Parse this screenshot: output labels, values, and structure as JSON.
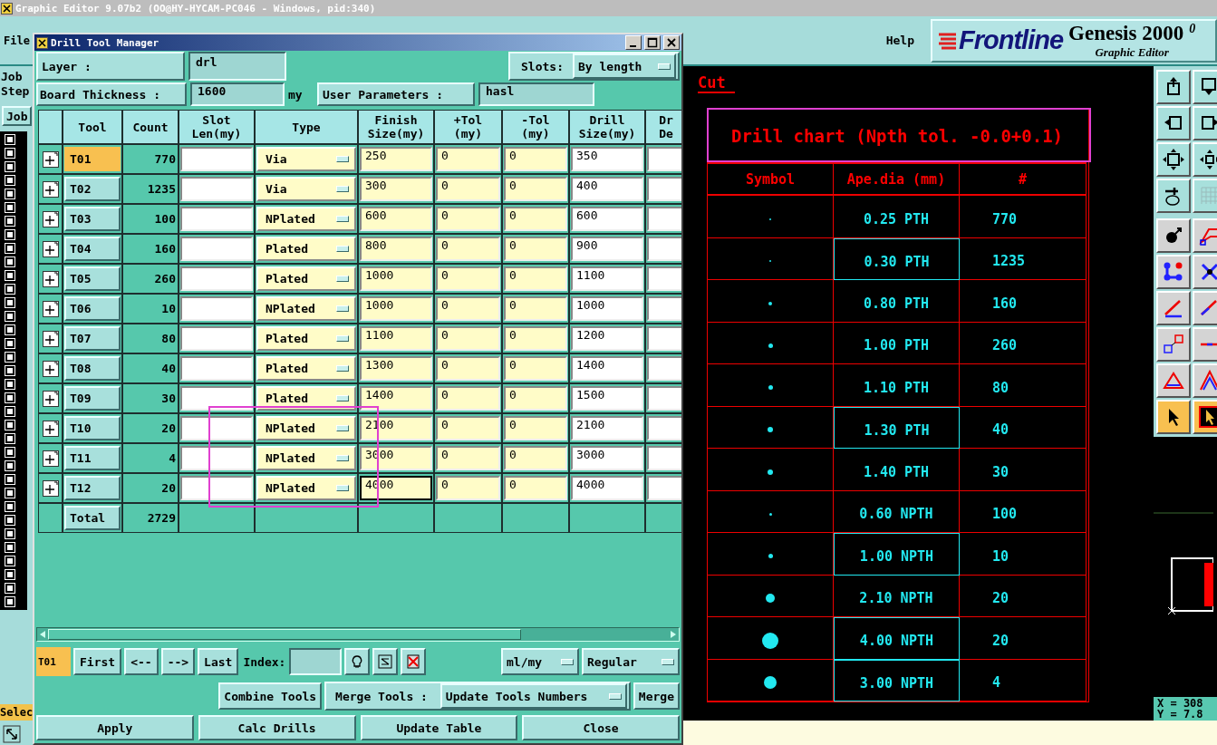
{
  "app_title": "Graphic Editor 9.07b2 (OO@HY-HYCAM-PC046 - Windows, pid:340)",
  "menu": [
    "File",
    "Help"
  ],
  "logo": {
    "brand": "Frontline",
    "product": "Genesis 2000",
    "version_mark": "0",
    "subtitle": "Graphic Editor"
  },
  "side_panel": {
    "labels": [
      "Job",
      "Step"
    ],
    "button": "Job",
    "footer": "Selec"
  },
  "canvas": {
    "caption": "Cut",
    "coords": [
      "X = 308",
      "Y = 7.8"
    ]
  },
  "drill_chart": {
    "title": "Drill chart (Npth tol. -0.0+0.1)",
    "columns": [
      "Symbol",
      "Ape.dia (mm)",
      "#"
    ],
    "rows": [
      {
        "dia": "0.25 PTH",
        "count": "770",
        "highlighted": false
      },
      {
        "dia": "0.30 PTH",
        "count": "1235",
        "highlighted": true
      },
      {
        "dia": "0.80 PTH",
        "count": "160",
        "highlighted": false
      },
      {
        "dia": "1.00 PTH",
        "count": "260",
        "highlighted": false
      },
      {
        "dia": "1.10 PTH",
        "count": "80",
        "highlighted": false
      },
      {
        "dia": "1.30 PTH",
        "count": "40",
        "highlighted": true
      },
      {
        "dia": "1.40 PTH",
        "count": "30",
        "highlighted": false
      },
      {
        "dia": "0.60 NPTH",
        "count": "100",
        "highlighted": false
      },
      {
        "dia": "1.00 NPTH",
        "count": "10",
        "highlighted": true
      },
      {
        "dia": "2.10 NPTH",
        "count": "20",
        "highlighted": false
      },
      {
        "dia": "4.00 NPTH",
        "count": "20",
        "highlighted": true
      },
      {
        "dia": "3.00 NPTH",
        "count": "4",
        "highlighted": true
      }
    ]
  },
  "toolbar": [
    {
      "selected": false
    },
    {
      "selected": false
    },
    {
      "selected": false
    },
    {
      "selected": false
    },
    {
      "selected": false
    },
    {
      "selected": false
    },
    {
      "selected": false
    },
    {
      "selected": false
    },
    {
      "selected": false
    },
    {
      "selected": false
    },
    {
      "selected": false
    },
    {
      "selected": false
    },
    {
      "selected": false
    },
    {
      "selected": false
    },
    {
      "selected": false
    },
    {
      "selected": false
    },
    {
      "selected": false
    },
    {
      "selected": false
    },
    {
      "selected": true
    },
    {
      "selected": true
    }
  ],
  "dialog": {
    "title": "Drill Tool Manager",
    "layer": {
      "label": "Layer :",
      "value": "drl"
    },
    "slots": {
      "label": "Slots:",
      "value": "By length"
    },
    "thickness": {
      "label": "Board Thickness :",
      "value": "1600",
      "unit": "my"
    },
    "user_params": {
      "label": "User Parameters :",
      "value": "hasl"
    },
    "table": {
      "columns": [
        "Tool",
        "Count",
        "Slot\nLen(my)",
        "Type",
        "Finish\nSize(my)",
        "+Tol\n(my)",
        "-Tol\n(my)",
        "Drill\nSize(my)",
        "Dr\nDe"
      ],
      "rows": [
        {
          "tool": "T01",
          "selected": true,
          "count": "770",
          "type": "Via",
          "finish": "250",
          "plus_tol": "0",
          "minus_tol": "0",
          "drill": "350",
          "focused": false
        },
        {
          "tool": "T02",
          "selected": false,
          "count": "1235",
          "type": "Via",
          "finish": "300",
          "plus_tol": "0",
          "minus_tol": "0",
          "drill": "400",
          "focused": false
        },
        {
          "tool": "T03",
          "selected": false,
          "count": "100",
          "type": "NPlated",
          "finish": "600",
          "plus_tol": "0",
          "minus_tol": "0",
          "drill": "600",
          "focused": false
        },
        {
          "tool": "T04",
          "selected": false,
          "count": "160",
          "type": "Plated",
          "finish": "800",
          "plus_tol": "0",
          "minus_tol": "0",
          "drill": "900",
          "focused": false
        },
        {
          "tool": "T05",
          "selected": false,
          "count": "260",
          "type": "Plated",
          "finish": "1000",
          "plus_tol": "0",
          "minus_tol": "0",
          "drill": "1100",
          "focused": false
        },
        {
          "tool": "T06",
          "selected": false,
          "count": "10",
          "type": "NPlated",
          "finish": "1000",
          "plus_tol": "0",
          "minus_tol": "0",
          "drill": "1000",
          "focused": false
        },
        {
          "tool": "T07",
          "selected": false,
          "count": "80",
          "type": "Plated",
          "finish": "1100",
          "plus_tol": "0",
          "minus_tol": "0",
          "drill": "1200",
          "focused": false
        },
        {
          "tool": "T08",
          "selected": false,
          "count": "40",
          "type": "Plated",
          "finish": "1300",
          "plus_tol": "0",
          "minus_tol": "0",
          "drill": "1400",
          "focused": false
        },
        {
          "tool": "T09",
          "selected": false,
          "count": "30",
          "type": "Plated",
          "finish": "1400",
          "plus_tol": "0",
          "minus_tol": "0",
          "drill": "1500",
          "focused": false
        },
        {
          "tool": "T10",
          "selected": false,
          "count": "20",
          "type": "NPlated",
          "finish": "2100",
          "plus_tol": "0",
          "minus_tol": "0",
          "drill": "2100",
          "focused": false
        },
        {
          "tool": "T11",
          "selected": false,
          "count": "4",
          "type": "NPlated",
          "finish": "3000",
          "plus_tol": "0",
          "minus_tol": "0",
          "drill": "3000",
          "focused": false
        },
        {
          "tool": "T12",
          "selected": false,
          "count": "20",
          "type": "NPlated",
          "finish": "4000",
          "plus_tol": "0",
          "minus_tol": "0",
          "drill": "4000",
          "focused": true
        }
      ],
      "total": {
        "label": "Total",
        "count": "2729"
      }
    },
    "nav": {
      "current": "T01",
      "buttons": [
        "First",
        "<--",
        "-->",
        "Last"
      ],
      "index_label": "Index:",
      "units": "ml/my",
      "mode": "Regular"
    },
    "merge": {
      "combine": "Combine Tools",
      "label": "Merge Tools :",
      "option": "Update Tools Numbers",
      "merge": "Merge"
    },
    "actions": [
      "Apply",
      "Calc Drills",
      "Update Table",
      "Close"
    ]
  }
}
